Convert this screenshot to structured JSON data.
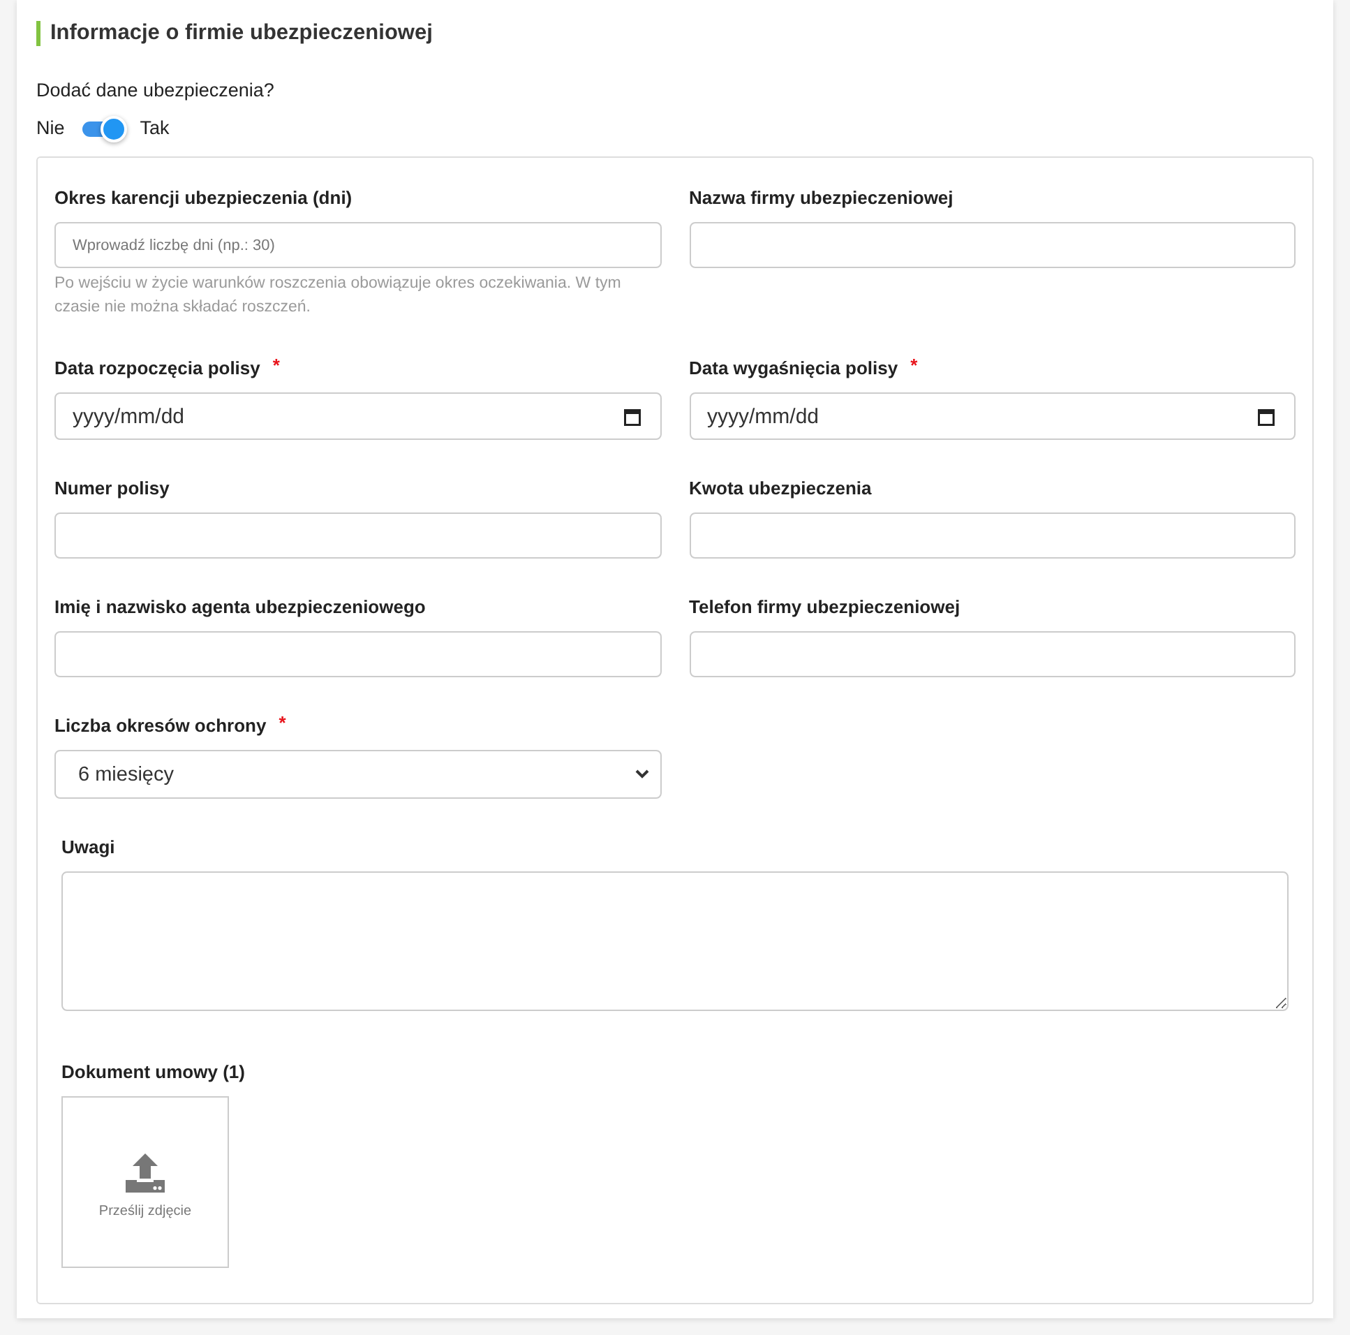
{
  "section": {
    "title": "Informacje o firmie ubezpieczeniowej"
  },
  "insurance_toggle": {
    "question": "Dodać dane ubezpieczenia?",
    "off_label": "Nie",
    "on_label": "Tak",
    "on": true
  },
  "fields": [
    {
      "kind": "text",
      "label": "Okres karencji ubezpieczenia (dni)",
      "placeholder": "Wprowadź liczbę dni (np.: 30)",
      "help": "Po wejściu w życie warunków roszczenia obowiązuje okres oczekiwania. W tym czasie nie można składać roszczeń."
    },
    {
      "kind": "text",
      "label": "Nazwa firmy ubezpieczeniowej"
    },
    {
      "kind": "date",
      "label": "Data rozpoczęcia polisy",
      "required_mark": "*",
      "placeholder": "yyyy/mm/dd"
    },
    {
      "kind": "date",
      "label": "Data wygaśnięcia polisy",
      "required_mark": "*",
      "placeholder": "yyyy/mm/dd"
    },
    {
      "kind": "text",
      "label": "Numer polisy"
    },
    {
      "kind": "text",
      "label": "Kwota ubezpieczenia"
    },
    {
      "kind": "text",
      "label": "Imię i nazwisko agenta ubezpieczeniowego"
    },
    {
      "kind": "text",
      "label": "Telefon firmy ubezpieczeniowej"
    },
    {
      "kind": "select",
      "label": "Liczba okresów ochrony",
      "required_mark": "*",
      "value": "6 miesięcy"
    }
  ],
  "notes": {
    "label": "Uwagi"
  },
  "document": {
    "label": "Dokument umowy (1)",
    "upload_text": "Prześlij zdjęcie"
  }
}
